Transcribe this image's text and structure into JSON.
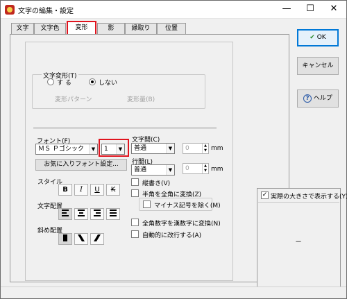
{
  "window": {
    "title": "文字の編集・設定",
    "minimize_glyph": "—",
    "maximize_glyph": "☐",
    "close_glyph": "✕"
  },
  "tabs": [
    {
      "label": "文字",
      "active": false
    },
    {
      "label": "文字色",
      "active": false
    },
    {
      "label": "変形",
      "active": true
    },
    {
      "label": "影",
      "active": false
    },
    {
      "label": "縁取り",
      "active": false
    },
    {
      "label": "位置",
      "active": false
    }
  ],
  "transform": {
    "group_label": "文字変形(T)",
    "radio_yes": "す る",
    "radio_no": "しない",
    "selected": "しない",
    "pattern_label": "変形パターン",
    "amount_label": "変形量(B)"
  },
  "font": {
    "label": "フォント(F)",
    "family_value": "ＭＳ Ｐゴシック",
    "size_value": "1",
    "favorite_button": "お気に入りフォント設定..."
  },
  "spacing": {
    "char_spacing_label": "文字間(C)",
    "char_spacing_value": "普通",
    "char_spacing_num": "0",
    "line_spacing_label": "行間(L)",
    "line_spacing_value": "普通",
    "line_spacing_num": "0",
    "unit": "mm"
  },
  "style": {
    "label": "スタイル",
    "bold": "B",
    "italic": "I",
    "underline": "U",
    "strike": "K"
  },
  "alignment": {
    "label": "文字配置"
  },
  "slant": {
    "label": "斜め配置"
  },
  "options": {
    "vertical": "縦書き(V)",
    "half_to_full": "半角を全角に変換(Z)",
    "remove_minus": "マイナス記号を除く(M)",
    "kanji_numerals": "全角数字を漢数字に変換(N)",
    "auto_wrap": "自動的に改行する(A)"
  },
  "side": {
    "ok": "OK",
    "cancel": "キャンセル",
    "help": "ヘルプ",
    "ok_glyph": "✔",
    "help_glyph": "?"
  },
  "preview": {
    "checkbox_label": "実際の大きさで表示する(Y)",
    "checked": true,
    "sample": "－"
  }
}
